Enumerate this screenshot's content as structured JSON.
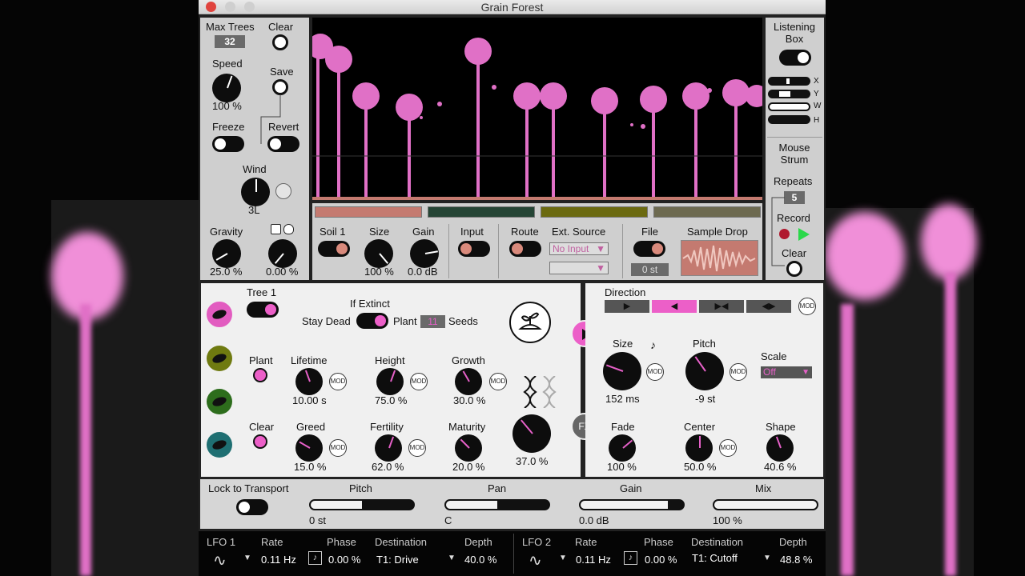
{
  "window": {
    "title": "Grain Forest"
  },
  "left_panel": {
    "max_trees_label": "Max Trees",
    "max_trees_value": "32",
    "clear_label": "Clear",
    "speed_label": "Speed",
    "speed_value": "100 %",
    "save_label": "Save",
    "freeze_label": "Freeze",
    "revert_label": "Revert",
    "wind_label": "Wind",
    "wind_value": "3L",
    "gravity_label": "Gravity",
    "gravity_value": "25.0 %",
    "random_value": "0.00 %"
  },
  "right_panel": {
    "listening_label": "Listening\nBox",
    "x": "X",
    "y": "Y",
    "w": "W",
    "h": "H",
    "mouse_strum_label": "Mouse\nStrum",
    "repeats_label": "Repeats",
    "repeats_value": "5",
    "record_label": "Record",
    "clear_label": "Clear"
  },
  "soil_bar": {
    "colors": [
      "#c47a70",
      "#254535",
      "#6b6a10",
      "#6d6a50"
    ],
    "soil_label": "Soil 1",
    "size_label": "Size",
    "size_value": "100 %",
    "gain_label": "Gain",
    "gain_value": "0.0 dB",
    "input_label": "Input",
    "route_label": "Route",
    "ext_source_label": "Ext. Source",
    "ext_source_value": "No Input",
    "file_label": "File",
    "file_value": "0 st",
    "sample_drop_label": "Sample Drop"
  },
  "tree_panel": {
    "tree_label": "Tree 1",
    "if_extinct_label": "If Extinct",
    "stay_dead_label": "Stay Dead",
    "plant_label": "Plant",
    "plant_value": "11",
    "seeds_label": "Seeds",
    "plant_btn_label": "Plant",
    "clear_btn_label": "Clear",
    "lifetime_label": "Lifetime",
    "lifetime_value": "10.00 s",
    "height_label": "Height",
    "height_value": "75.0 %",
    "growth_label": "Growth",
    "growth_value": "30.0 %",
    "greed_label": "Greed",
    "greed_value": "15.0 %",
    "fertility_label": "Fertility",
    "fertility_value": "62.0 %",
    "maturity_label": "Maturity",
    "maturity_value": "20.0 %",
    "dna_value": "37.0 %",
    "leaf_colors": [
      "#e25cc0",
      "#6f7a10",
      "#2d6d1c",
      "#1f6f72"
    ],
    "fx_label": "FX"
  },
  "grain_panel": {
    "direction_label": "Direction",
    "dir_buttons": [
      "▶",
      "◀",
      "▶◀",
      "◀▶"
    ],
    "size_label": "Size",
    "size_value": "152 ms",
    "pitch_label": "Pitch",
    "pitch_value": "-9 st",
    "scale_label": "Scale",
    "scale_value": "Off",
    "fade_label": "Fade",
    "fade_value": "100 %",
    "center_label": "Center",
    "center_value": "50.0 %",
    "shape_label": "Shape",
    "shape_value": "40.6 %"
  },
  "mixer": {
    "lock_label": "Lock to Transport",
    "pitch_label": "Pitch",
    "pitch_value": "0 st",
    "pitch_fill": 0.5,
    "pan_label": "Pan",
    "pan_value": "C",
    "pan_fill": 0.5,
    "gain_label": "Gain",
    "gain_value": "0.0 dB",
    "gain_fill": 0.85,
    "mix_label": "Mix",
    "mix_value": "100 %",
    "mix_fill": 1.0
  },
  "lfo1": {
    "label": "LFO 1",
    "rate_label": "Rate",
    "rate_value": "0.11 Hz",
    "phase_label": "Phase",
    "phase_value": "0.00 %",
    "dest_label": "Destination",
    "dest_value": "T1: Drive",
    "depth_label": "Depth",
    "depth_value": "40.0 %"
  },
  "lfo2": {
    "label": "LFO 2",
    "rate_label": "Rate",
    "rate_value": "0.11 Hz",
    "phase_label": "Phase",
    "phase_value": "0.00 %",
    "dest_label": "Destination",
    "dest_value": "T1: Cutoff",
    "depth_label": "Depth",
    "depth_value": "48.8 %"
  },
  "colors": {
    "accent": "#ec5fc8",
    "panel": "#cfcfcf",
    "light_panel": "#f0f0f0"
  }
}
